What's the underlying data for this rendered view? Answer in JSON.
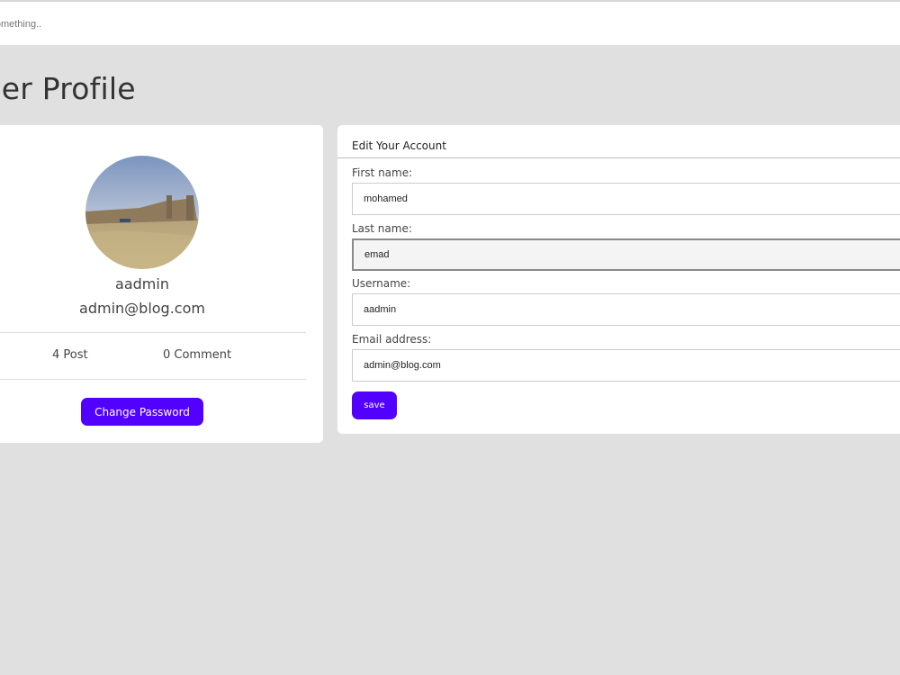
{
  "search": {
    "placeholder": "Enter something.."
  },
  "page": {
    "title": "User Profile"
  },
  "profile": {
    "username": "aadmin",
    "email": "admin@blog.com",
    "posts_label": "4 Post",
    "comments_label": "0 Comment",
    "change_password_label": "Change Password"
  },
  "account_form": {
    "title": "Edit Your Account",
    "fields": [
      {
        "label": "First name:",
        "value": "mohamed"
      },
      {
        "label": "Last name:",
        "value": "emad"
      },
      {
        "label": "Username:",
        "value": "aadmin"
      },
      {
        "label": "Email address:",
        "value": "admin@blog.com"
      }
    ],
    "save_label": "save"
  },
  "colors": {
    "accent": "#5200ff",
    "background": "#e0e0e0",
    "card": "#ffffff"
  }
}
